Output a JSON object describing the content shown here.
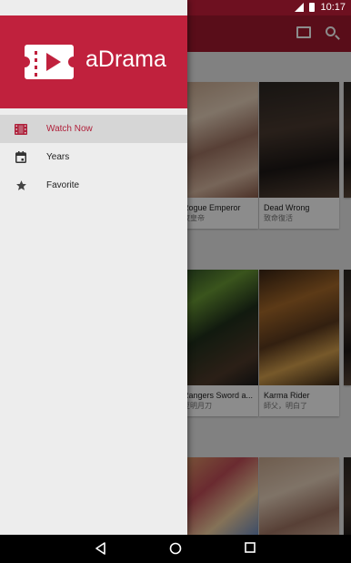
{
  "status_bar": {
    "time": "10:17"
  },
  "drawer": {
    "brand": "aDrama",
    "menu": [
      {
        "label": "Watch Now",
        "icon": "film-icon",
        "active": true
      },
      {
        "label": "Years",
        "icon": "calendar-icon",
        "active": false
      },
      {
        "label": "Favorite",
        "icon": "star-icon",
        "active": false
      }
    ]
  },
  "background": {
    "cards": [
      {
        "title": "Rogue Emperor",
        "subtitle": "夜皇帝"
      },
      {
        "title": "Dead Wrong",
        "subtitle": "致命復活"
      },
      {
        "title": "Rangers Sword a...",
        "subtitle": "夏明月刀"
      },
      {
        "title": "Karma Rider",
        "subtitle": "師父，明白了"
      }
    ]
  },
  "colors": {
    "accent": "#c0213d",
    "status_bar": "#6e1020",
    "drawer_bg": "#ededed"
  }
}
